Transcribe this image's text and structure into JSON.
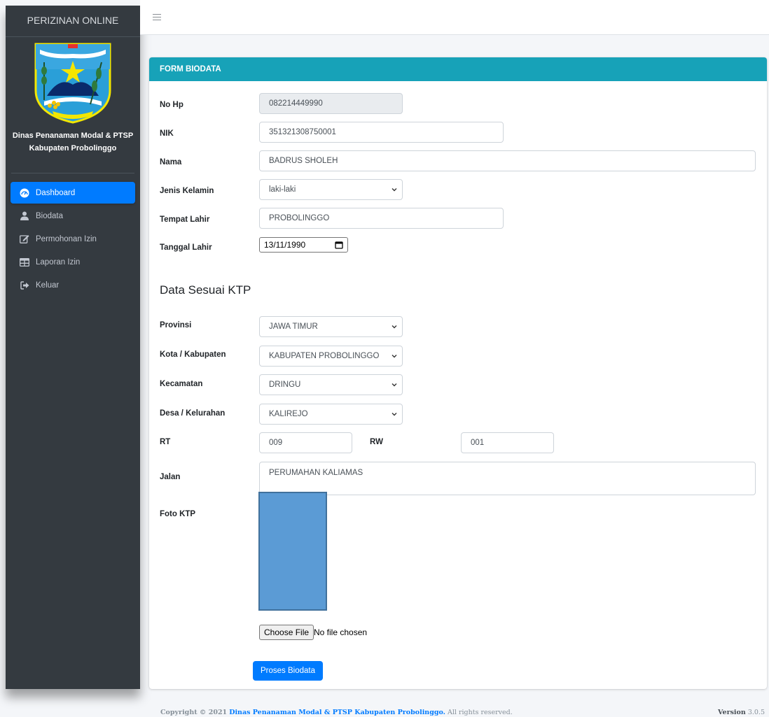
{
  "app": {
    "brand": "PERIZINAN ONLINE",
    "institution_line1": "Dinas Penanaman Modal & PTSP",
    "institution_line2": "Kabupaten Probolinggo"
  },
  "sidebar": {
    "items": [
      {
        "label": "Dashboard",
        "icon": "dashboard-icon",
        "active": true
      },
      {
        "label": "Biodata",
        "icon": "user-icon",
        "active": false
      },
      {
        "label": "Permohonan Izin",
        "icon": "edit-icon",
        "active": false
      },
      {
        "label": "Laporan Izin",
        "icon": "table-icon",
        "active": false
      },
      {
        "label": "Keluar",
        "icon": "sign-out-icon",
        "active": false
      }
    ]
  },
  "form": {
    "title": "FORM BIODATA",
    "no_hp": {
      "label": "No Hp",
      "value": "082214449990"
    },
    "nik": {
      "label": "NIK",
      "value": "351321308750001"
    },
    "nama": {
      "label": "Nama",
      "value": "BADRUS SHOLEH"
    },
    "jenis_kelamin": {
      "label": "Jenis Kelamin",
      "value": "laki-laki"
    },
    "tempat_lahir": {
      "label": "Tempat Lahir",
      "value": "PROBOLINGGO"
    },
    "tanggal_lahir": {
      "label": "Tanggal Lahir",
      "value": "13/11/1990"
    },
    "section_ktp": "Data Sesuai KTP",
    "provinsi": {
      "label": "Provinsi",
      "value": "JAWA TIMUR"
    },
    "kota": {
      "label": "Kota / Kabupaten",
      "value": "KABUPATEN PROBOLINGGO"
    },
    "kecamatan": {
      "label": "Kecamatan",
      "value": "DRINGU"
    },
    "desa": {
      "label": "Desa / Kelurahan",
      "value": "KALIREJO"
    },
    "rt": {
      "label": "RT",
      "value": "009"
    },
    "rw": {
      "label": "RW",
      "value": "001"
    },
    "jalan": {
      "label": "Jalan",
      "value": "PERUMAHAN KALIAMAS"
    },
    "foto_ktp": {
      "label": "Foto KTP",
      "choose_label": "Choose File",
      "file_status": "No file chosen"
    },
    "submit_label": "Proses Biodata"
  },
  "footer": {
    "copyright_prefix": "Copyright © 2021",
    "copyright_link": "Dinas Penanaman Modal & PTSP Kabupaten Probolinggo.",
    "copyright_suffix": "All rights reserved.",
    "version_label": "Version",
    "version_value": "3.0.5"
  },
  "colors": {
    "sidebar_bg": "#343a40",
    "header_accent": "#17a2b8",
    "primary": "#007bff",
    "ktp_placeholder": "#5b9bd5"
  }
}
